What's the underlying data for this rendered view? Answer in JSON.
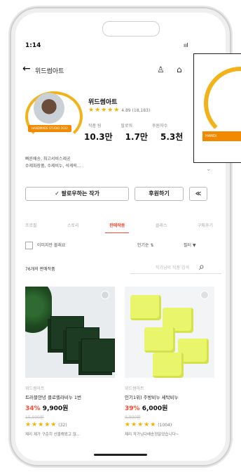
{
  "status": {
    "time": "1:14"
  },
  "nav": {
    "title": "위드썸아트"
  },
  "profile": {
    "name": "위드썸아트",
    "rating_text": "4.89 (18,183)",
    "badge_text": "HANDMADE STUDIO 2022",
    "stats": {
      "labels": [
        "작품 팅",
        "팔로워",
        "후원자수"
      ],
      "values": [
        "10.3만",
        "1.7만",
        "5.3천"
      ]
    },
    "description_lines": [
      "빠른배송, 최고서비스제공",
      "수제화장품, 수제비누, 석케릭..."
    ]
  },
  "buttons": {
    "follow": "✓ 팔로우하는 작가",
    "support": "후원하기"
  },
  "tabs": [
    "프로필",
    "스토리",
    "판매작품",
    "클래스",
    "구매후기"
  ],
  "filters": {
    "checkbox": "이미지만 볼래요",
    "sort": "인기순 ⇅",
    "filter": "필터 ▼"
  },
  "listing": {
    "count": "76개의 판매작품",
    "search_placeholder": "작가님의 작품 검색"
  },
  "products": [
    {
      "shop": "위드썸아트",
      "title": "트러블안녕 클로렐라비누 1번",
      "discount": "34%",
      "price": "9,900원",
      "original": "15,000원",
      "reviews": "(32)",
      "review": "제리 제가 구준히 선물해왔고 많..."
    },
    {
      "shop": "위드썸아트",
      "title": "인기1위) 주방비누 세탁비누",
      "discount": "39%",
      "price": "6,000원",
      "original": "9,900원",
      "reviews": "(1004)",
      "review": "제리 작가님다배송정말었습니다~"
    }
  ],
  "overlay": {
    "badge_text": "HANDI"
  }
}
